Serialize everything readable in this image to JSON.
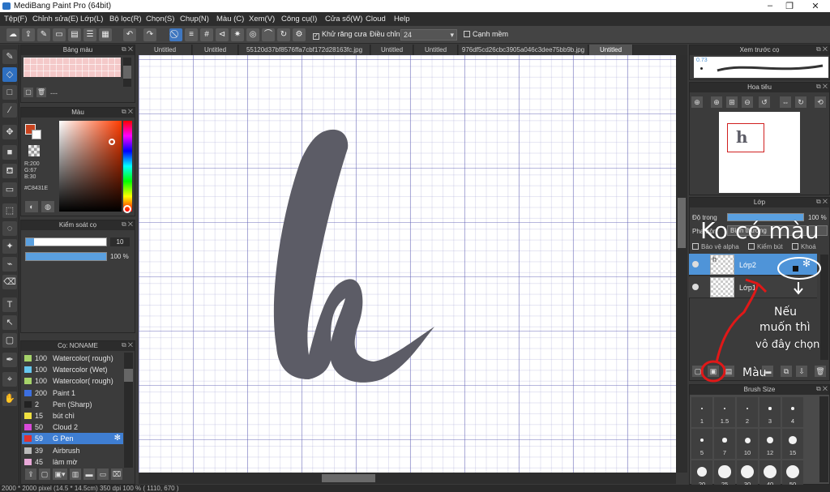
{
  "window": {
    "title": "MediBang Paint Pro (64bit)",
    "controls": [
      "–",
      "❐",
      "✕"
    ]
  },
  "menu": [
    "Tệp(F)",
    "Chỉnh sửa(E)",
    "Lớp(L)",
    "Bộ lọc(R)",
    "Chọn(S)",
    "Chụp(N)",
    "Màu (C)",
    "Xem(V)",
    "Công cụ(I)",
    "Cửa sổ(W)",
    "Cloud",
    "Help"
  ],
  "toolbar": {
    "antialias_label": "Khử răng cưa",
    "adjust_label": "Điều chỉnh",
    "adjust_value": "24",
    "edge_label": "Cạnh mềm"
  },
  "tabs": [
    "Untitled",
    "Untitled",
    "55120d37bf8576ffa7cbf172d28163fc.jpg",
    "Untitled",
    "Untitled",
    "976df5cd26cbc3905a046c3dee75bb9b.jpg",
    "Untitled"
  ],
  "panels": {
    "palette": {
      "title": "Bảng màu",
      "extra": "---"
    },
    "color": {
      "title": "Màu",
      "r": "R:200",
      "g": "G:67",
      "b": "B:30",
      "hex": "#C8431E",
      "main_color": "#c8431e"
    },
    "brush_control": {
      "title": "Kiểm soát cọ",
      "size_value": "10",
      "opacity_value": "100 %",
      "size_fraction": 0.1,
      "opacity_fraction": 1.0
    },
    "brush_list": {
      "title": "Cọ: NONAME",
      "items": [
        {
          "size": "100",
          "name": "Watercolor( rough)",
          "color": "#a6d36a",
          "selected": false
        },
        {
          "size": "100",
          "name": "Watercolor (Wet)",
          "color": "#66c7ee",
          "selected": false
        },
        {
          "size": "100",
          "name": "Watercolor( rough)",
          "color": "#a6d36a",
          "selected": false
        },
        {
          "size": "200",
          "name": "Paint 1",
          "color": "#3c6fe0",
          "selected": false
        },
        {
          "size": "2",
          "name": "Pen (Sharp)",
          "color": "#222222",
          "selected": false
        },
        {
          "size": "15",
          "name": "bút chì",
          "color": "#f0e040",
          "selected": false
        },
        {
          "size": "50",
          "name": "Cloud 2",
          "color": "#d94ad9",
          "selected": false
        },
        {
          "size": "59",
          "name": "G Pen",
          "color": "#e03030",
          "selected": true
        },
        {
          "size": "39",
          "name": "Airbrush",
          "color": "#bbbbbb",
          "selected": false
        },
        {
          "size": "45",
          "name": "làm mờ",
          "color": "#e9a9d9",
          "selected": false
        }
      ]
    },
    "preview_brush": {
      "title": "Xem trước cọ",
      "value": "0.73"
    },
    "navigator": {
      "title": "Hoa tiêu"
    },
    "layers": {
      "title": "Lớp",
      "opacity_label": "Độ trong",
      "opacity_value": "100 %",
      "blend_label": "Pha trộn",
      "blend_value": "Bình thường",
      "protect_label": "Bảo vệ alpha",
      "clip_label": "Kiểm bút",
      "lock_label": "Khoá",
      "items": [
        {
          "name": "Lớp2",
          "selected": true
        },
        {
          "name": "Lớp1",
          "selected": false
        }
      ]
    },
    "brush_size": {
      "title": "Brush Size",
      "sizes": [
        "1",
        "1.5",
        "2",
        "3",
        "4",
        "5",
        "7",
        "10",
        "12",
        "15",
        "20",
        "25",
        "30",
        "40",
        "50"
      ]
    }
  },
  "annotations": {
    "top": "Ko có màu",
    "note_line1": "Nếu",
    "note_line2": "muốn thì",
    "note_line3": "vô đây chọn",
    "note_line4": "Màu"
  },
  "status": {
    "text": "2000 * 2000 pixel   (14.5 * 14.5cm)   350 dpi   100 %   ( 1110, 670 )"
  }
}
